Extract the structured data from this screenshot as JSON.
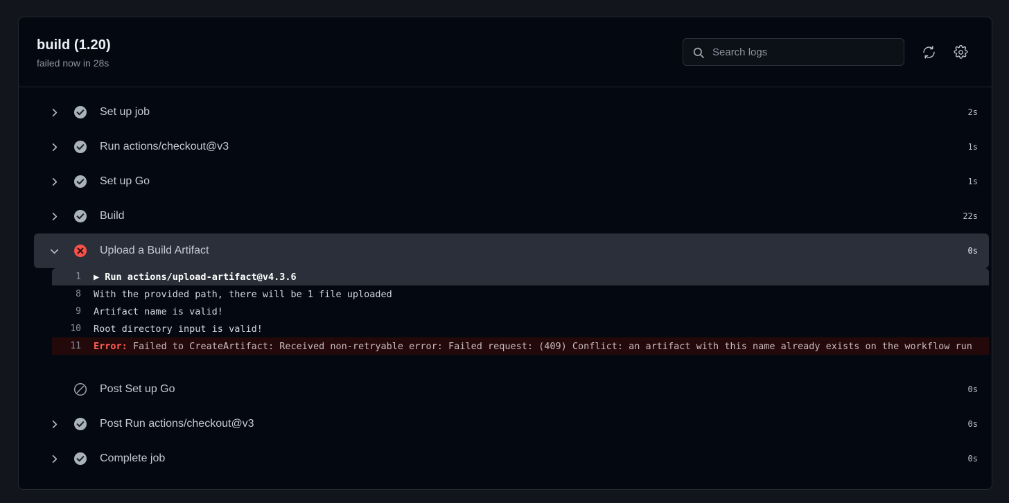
{
  "header": {
    "job_title": "build (1.20)",
    "job_status": "failed now in 28s",
    "search_placeholder": "Search logs",
    "search_value": "",
    "search_icon": "search-icon",
    "refresh_icon": "refresh-icon",
    "settings_icon": "gear-icon"
  },
  "steps": [
    {
      "label": "Set up job",
      "duration": "2s",
      "status": "success",
      "chevron": "chevron-right",
      "expanded": false
    },
    {
      "label": "Run actions/checkout@v3",
      "duration": "1s",
      "status": "success",
      "chevron": "chevron-right",
      "expanded": false
    },
    {
      "label": "Set up Go",
      "duration": "1s",
      "status": "success",
      "chevron": "chevron-right",
      "expanded": false
    },
    {
      "label": "Build",
      "duration": "22s",
      "status": "success",
      "chevron": "chevron-right",
      "expanded": false
    },
    {
      "label": "Upload a Build Artifact",
      "duration": "0s",
      "status": "failure",
      "chevron": "chevron-down",
      "expanded": true
    },
    {
      "label": "Post Set up Go",
      "duration": "0s",
      "status": "skipped",
      "chevron": "none",
      "expanded": false
    },
    {
      "label": "Post Run actions/checkout@v3",
      "duration": "0s",
      "status": "success",
      "chevron": "chevron-right",
      "expanded": false
    },
    {
      "label": "Complete job",
      "duration": "0s",
      "status": "success",
      "chevron": "chevron-right",
      "expanded": false
    }
  ],
  "log": {
    "lines": [
      {
        "number": "1",
        "marker": "▶ ",
        "text": "Run actions/upload-artifact@v4.3.6",
        "style": "first"
      },
      {
        "number": "8",
        "marker": "",
        "text": "With the provided path, there will be 1 file uploaded",
        "style": "normal"
      },
      {
        "number": "9",
        "marker": "",
        "text": "Artifact name is valid!",
        "style": "normal"
      },
      {
        "number": "10",
        "marker": "",
        "text": "Root directory input is valid!",
        "style": "normal"
      },
      {
        "number": "11",
        "marker": "",
        "error_tag": "Error:",
        "text": " Failed to CreateArtifact: Received non-retryable error: Failed request: (409) Conflict: an artifact with this name already exists on the workflow run",
        "style": "error"
      }
    ]
  },
  "colors": {
    "page_bg": "#12151c",
    "card_bg": "#040810",
    "selected_row": "#2a2f39",
    "error_red": "#ff5f56",
    "failure_icon": "#f85149",
    "success_icon": "#b1b8c0",
    "error_row_bg": "#24090b",
    "text_primary": "#c3cbd6"
  }
}
